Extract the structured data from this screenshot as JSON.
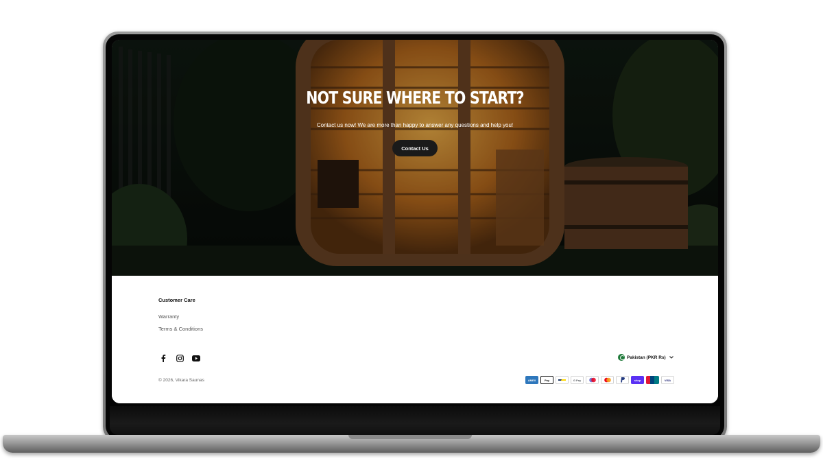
{
  "hero": {
    "title": "Not sure where to start?",
    "subtitle": "Contact us now! We are more than happy to answer any questions and help you!",
    "cta_label": "Contact Us"
  },
  "footer": {
    "heading": "Customer Care",
    "links": [
      "Warranty",
      "Terms & Conditions"
    ],
    "social": [
      "facebook-icon",
      "instagram-icon",
      "youtube-icon"
    ],
    "country_selector": "Pakistan (PKR Rs)",
    "copyright": "© 2026, Vikara Saunas",
    "payment_methods": [
      "American Express",
      "Apple Pay",
      "Bancontact",
      "Google Pay",
      "Maestro",
      "Mastercard",
      "PayPal",
      "Shop Pay",
      "Union Pay",
      "Visa"
    ],
    "payment_labels": {
      "amex": "AMEX",
      "applepay": "Pay",
      "googlepay": "G Pay",
      "shoppay": "shop",
      "visa": "VISA"
    }
  },
  "colors": {
    "cta_background": "#1a1a1a",
    "shop_pay": "#5a31f4",
    "amex": "#2e77bc"
  }
}
